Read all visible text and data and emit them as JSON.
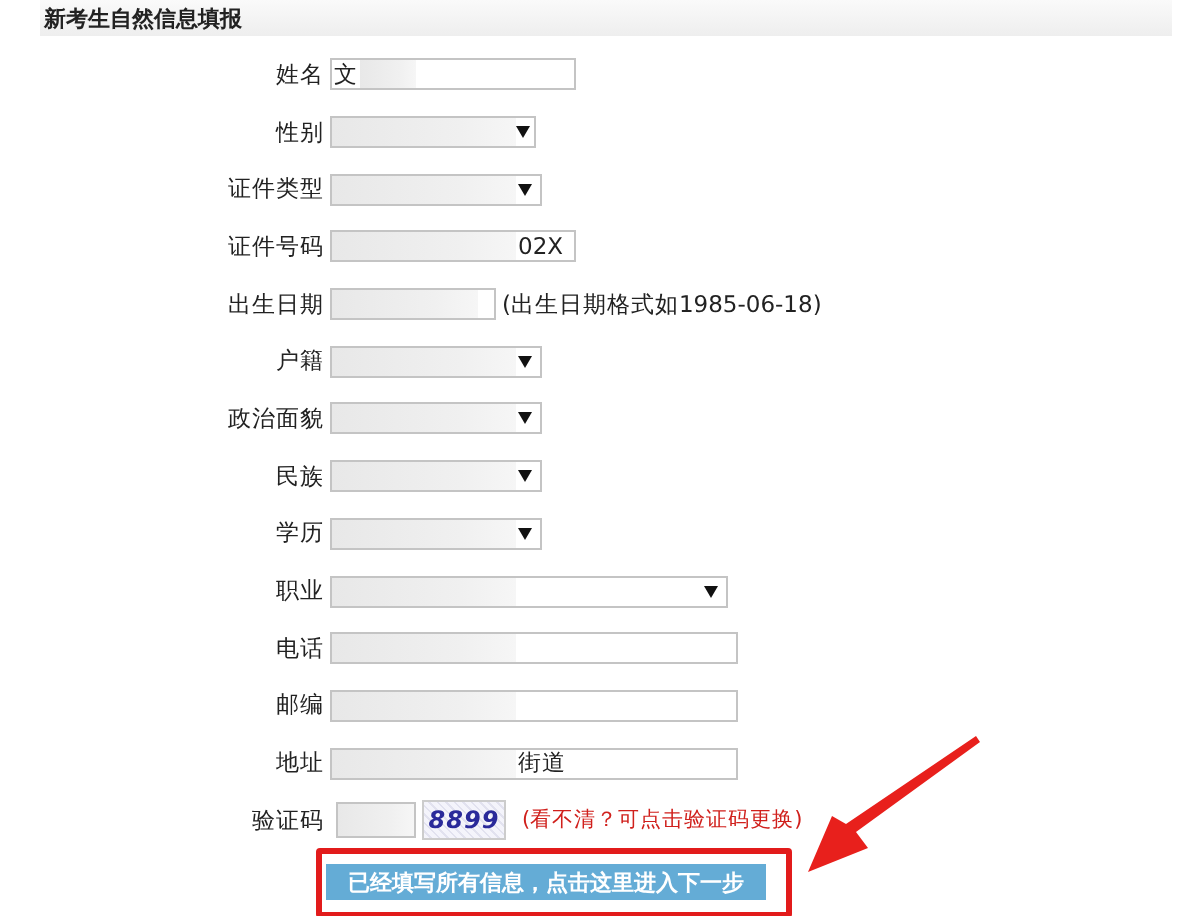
{
  "header": {
    "title": "新考生自然信息填报"
  },
  "fields": [
    {
      "label": "姓名",
      "kind": "text",
      "value": "文",
      "redacted": true,
      "value_first": true
    },
    {
      "label": "性别",
      "kind": "select",
      "redacted": true
    },
    {
      "label": "证件类型",
      "kind": "select",
      "redacted": true
    },
    {
      "label": "证件号码",
      "kind": "text",
      "value": "02X",
      "redacted": true
    },
    {
      "label": "出生日期",
      "kind": "date",
      "redacted": true,
      "hint": "(出生日期格式如1985-06-18)"
    },
    {
      "label": "户籍",
      "kind": "select",
      "redacted": true
    },
    {
      "label": "政治面貌",
      "kind": "select",
      "redacted": true
    },
    {
      "label": "民族",
      "kind": "select",
      "redacted": true
    },
    {
      "label": "学历",
      "kind": "select",
      "redacted": true
    },
    {
      "label": "职业",
      "kind": "select",
      "redacted": true
    },
    {
      "label": "电话",
      "kind": "text",
      "redacted": true
    },
    {
      "label": "邮编",
      "kind": "text",
      "redacted": true
    },
    {
      "label": "地址",
      "kind": "text",
      "value": "街道",
      "redacted": true
    },
    {
      "label": "验证码",
      "kind": "captcha",
      "redacted": true,
      "captcha_text": "8899",
      "hint": "(看不清？可点击验证码更换)"
    }
  ],
  "submit": {
    "label": "已经填写所有信息，点击这里进入下一步"
  },
  "annotation": {
    "kind": "arrow-box"
  }
}
